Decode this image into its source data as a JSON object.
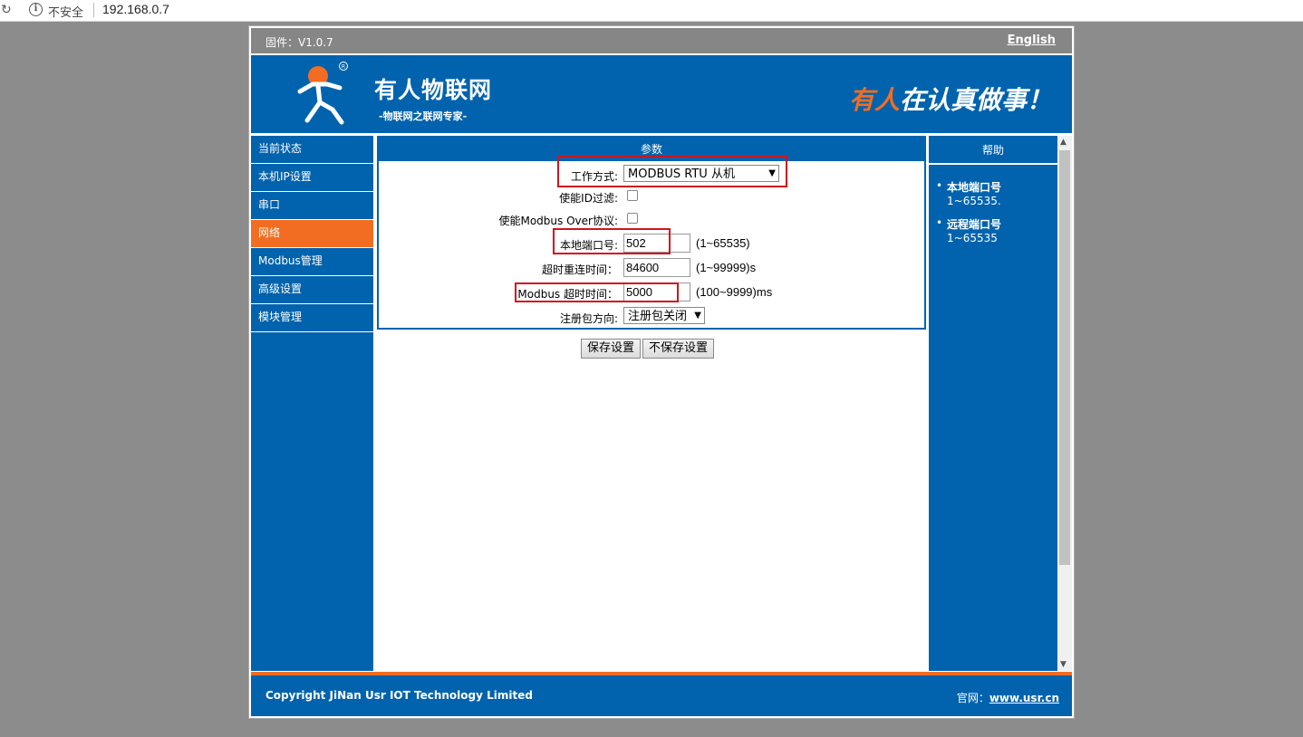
{
  "browser": {
    "security_label": "不安全",
    "url": "192.168.0.7"
  },
  "topbar": {
    "firmware": "固件：V1.0.7",
    "language_link": "English"
  },
  "banner": {
    "brand": "有人物联网",
    "brand_sub": "-物联网之联网专家-",
    "slogan_highlight": "有人",
    "slogan_rest": "在认真做事！",
    "registered_mark": "R"
  },
  "nav": {
    "items": [
      {
        "label": "当前状态"
      },
      {
        "label": "本机IP设置"
      },
      {
        "label": "串口"
      },
      {
        "label": "网络",
        "active": true
      },
      {
        "label": "Modbus管理"
      },
      {
        "label": "高级设置"
      },
      {
        "label": "模块管理"
      }
    ]
  },
  "main": {
    "title": "参数",
    "work_mode": {
      "label": "工作方式:",
      "value": "MODBUS  RTU  从机"
    },
    "id_filter": {
      "label": "使能ID过滤:",
      "checked": false
    },
    "modbus_over": {
      "label": "使能Modbus Over协议:",
      "checked": false
    },
    "local_port": {
      "label": "本地端口号:",
      "value": "502",
      "hint": "(1~65535)"
    },
    "reconnect_timeout": {
      "label": "超时重连时间：",
      "value": "84600",
      "hint": "(1~99999)s"
    },
    "modbus_timeout": {
      "label": "Modbus 超时时间：",
      "value": "5000",
      "hint": "(100~9999)ms"
    },
    "register_packet": {
      "label": "注册包方向:",
      "value": "注册包关闭"
    },
    "save_button": "保存设置",
    "nosave_button": "不保存设置"
  },
  "help": {
    "title": "帮助",
    "items": [
      {
        "term": "本地端口号",
        "desc": "1~65535."
      },
      {
        "term": "远程端口号",
        "desc": "1~65535"
      }
    ]
  },
  "footer": {
    "copyright": "Copyright JiNan Usr IOT Technology Limited",
    "site_label": "官网：",
    "site_link": "www.usr.cn"
  },
  "colors": {
    "brand_blue": "#0163ad",
    "accent_orange": "#f26d21",
    "highlight_red": "#d0141c"
  }
}
